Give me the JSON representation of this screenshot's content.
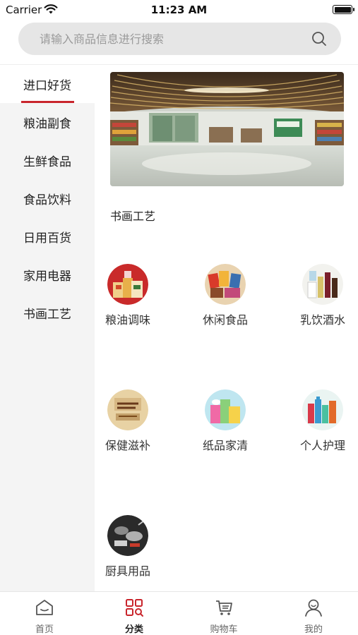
{
  "status_bar": {
    "carrier": "Carrier",
    "time": "11:23 AM"
  },
  "search": {
    "placeholder": "请输入商品信息进行搜索"
  },
  "sidebar": {
    "items": [
      {
        "label": "进口好货",
        "active": true
      },
      {
        "label": "粮油副食"
      },
      {
        "label": "生鲜食品"
      },
      {
        "label": "食品饮料"
      },
      {
        "label": "日用百货"
      },
      {
        "label": "家用电器"
      },
      {
        "label": "书画工艺"
      }
    ]
  },
  "main": {
    "section_title": "书画工艺",
    "categories": [
      {
        "label": "粮油调味",
        "icon": "grain-oil-icon"
      },
      {
        "label": "休闲食品",
        "icon": "snacks-icon"
      },
      {
        "label": "乳饮酒水",
        "icon": "drinks-icon"
      },
      {
        "label": "保健滋补",
        "icon": "health-supplement-icon"
      },
      {
        "label": "纸品家清",
        "icon": "paper-cleaning-icon"
      },
      {
        "label": "个人护理",
        "icon": "personal-care-icon"
      },
      {
        "label": "厨具用品",
        "icon": "kitchenware-icon"
      }
    ]
  },
  "tab_bar": {
    "tabs": [
      {
        "label": "首页",
        "icon": "home-icon"
      },
      {
        "label": "分类",
        "icon": "category-icon",
        "active": true
      },
      {
        "label": "购物车",
        "icon": "cart-icon"
      },
      {
        "label": "我的",
        "icon": "user-icon"
      }
    ]
  },
  "colors": {
    "accent": "#c9252c",
    "sidebar_bg": "#f4f4f4",
    "search_bg": "#e6e6e6"
  }
}
